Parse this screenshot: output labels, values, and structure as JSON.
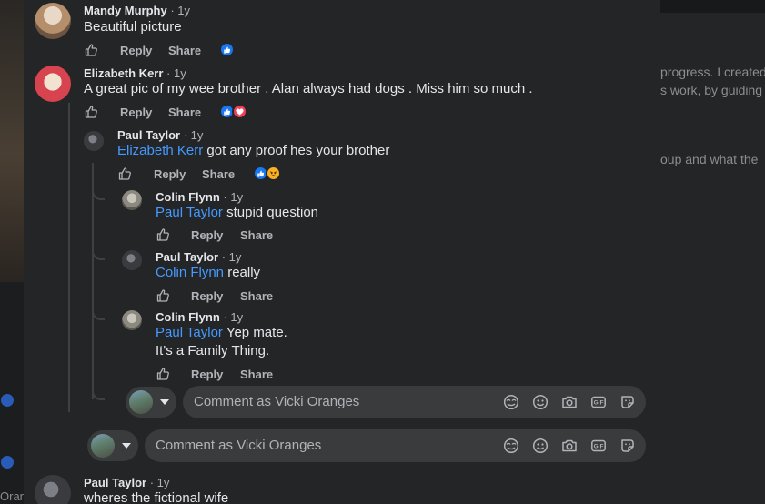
{
  "background": {
    "right_lines": [
      "progress. I created",
      "s work, by guiding",
      "oup and what the"
    ],
    "left_text": "Oran"
  },
  "actions": {
    "reply": "Reply",
    "share": "Share"
  },
  "comments": [
    {
      "name": "Mandy Murphy",
      "time": " · 1y",
      "text": "Beautiful picture"
    },
    {
      "name": "Elizabeth Kerr",
      "time": " · 1y",
      "text": "A great pic of my wee brother . Alan always had dogs . Miss him so much ."
    },
    {
      "name": "Paul Taylor",
      "time": " · 1y",
      "mention": "Elizabeth Kerr",
      "text": " got any proof hes your brother"
    },
    {
      "name": "Colin Flynn",
      "time": " · 1y",
      "mention": "Paul Taylor",
      "text": " stupid question"
    },
    {
      "name": "Paul Taylor",
      "time": " · 1y",
      "mention": "Colin Flynn",
      "text": " really"
    },
    {
      "name": "Colin Flynn",
      "time": " · 1y",
      "mention": "Paul Taylor",
      "text": " Yep mate.",
      "text2": "It's a Family Thing."
    },
    {
      "name": "Paul Taylor",
      "time": " · 1y",
      "text": "wheres the fictional wife"
    }
  ],
  "composer": {
    "placeholder": "Comment as Vicki Oranges"
  },
  "colors": {
    "background": "#242526",
    "text": "#e4e6eb",
    "secondary": "#b0b3b8",
    "link": "#4599ff",
    "like": "#1877f2",
    "love": "#f33e58",
    "angry": "#e9710f"
  },
  "icons": [
    "like-outline-icon",
    "like-reaction-icon",
    "love-reaction-icon",
    "angry-reaction-icon",
    "avatar-icon",
    "gif-icon",
    "emoji-icon",
    "camera-icon",
    "sticker-icon",
    "avatar-sticker-icon",
    "caret-down-icon"
  ]
}
